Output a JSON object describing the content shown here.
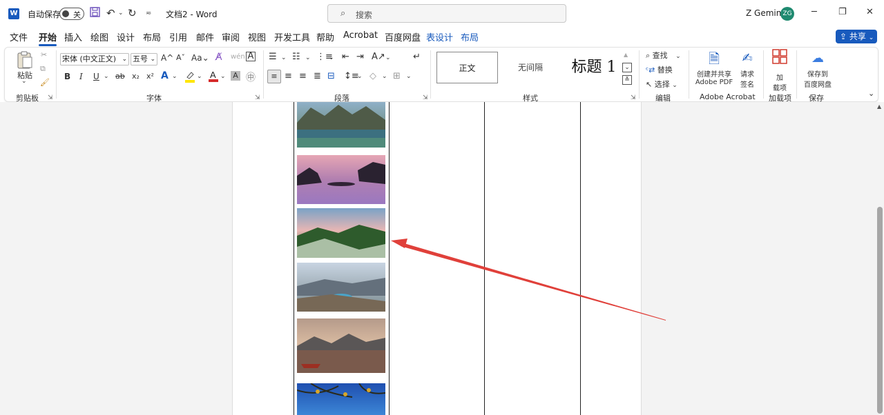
{
  "titlebar": {
    "autosave_label": "自动保存",
    "autosave_state": "关",
    "doc_title": "文档2 - Word",
    "search_placeholder": "搜索",
    "user_name": "Z Gemini",
    "avatar_initials": "ZG"
  },
  "menu": {
    "tabs": [
      "文件",
      "开始",
      "插入",
      "绘图",
      "设计",
      "布局",
      "引用",
      "邮件",
      "审阅",
      "视图",
      "开发工具",
      "帮助",
      "Acrobat",
      "百度网盘",
      "表设计",
      "布局"
    ],
    "active_tab": "开始",
    "share_label": "共享"
  },
  "ribbon": {
    "clipboard": {
      "paste_label": "粘贴",
      "group_label": "剪贴板"
    },
    "font": {
      "font_name": "宋体 (中文正文)",
      "font_size": "五号",
      "group_label": "字体"
    },
    "paragraph": {
      "group_label": "段落"
    },
    "styles": {
      "items": [
        "正文",
        "无间隔",
        "标题 1"
      ],
      "group_label": "样式"
    },
    "editing": {
      "find_label": "查找",
      "replace_label": "替换",
      "select_label": "选择",
      "group_label": "编辑"
    },
    "acrobat": {
      "create_share_line1": "创建并共享",
      "create_share_line2": "Adobe PDF",
      "request_sign_line1": "请求",
      "request_sign_line2": "签名",
      "group_label": "Adobe Acrobat"
    },
    "addins": {
      "label_line1": "加",
      "label_line2": "载项",
      "group_label": "加载项"
    },
    "save": {
      "label_line1": "保存到",
      "label_line2": "百度网盘",
      "group_label": "保存"
    }
  },
  "colors": {
    "accent": "#185abd",
    "arrow": "#e0403a",
    "avatar": "#1f8a70"
  },
  "document": {
    "photos": [
      "mountain-lake-icon",
      "purple-sunset-lake-icon",
      "flower-meadow-icon",
      "mountain-river-icon",
      "dusk-lake-boat-icon",
      "blue-sky-branches-icon"
    ]
  }
}
